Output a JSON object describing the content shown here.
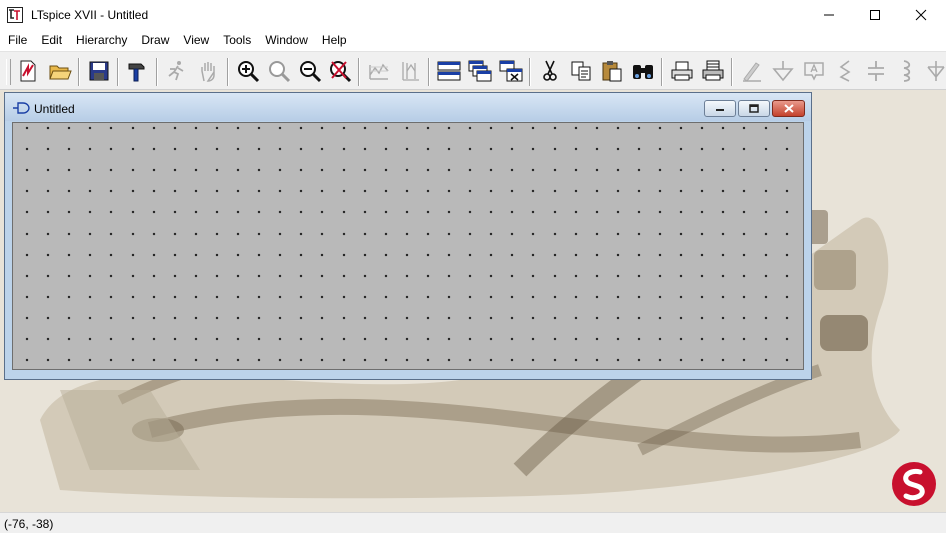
{
  "window": {
    "title": "LTspice XVII - Untitled",
    "controls": {
      "minimize": "minimize-icon",
      "maximize": "maximize-icon",
      "close": "close-icon"
    }
  },
  "menu": {
    "items": [
      {
        "label": "File"
      },
      {
        "label": "Edit"
      },
      {
        "label": "Hierarchy"
      },
      {
        "label": "Draw"
      },
      {
        "label": "View"
      },
      {
        "label": "Tools"
      },
      {
        "label": "Window"
      },
      {
        "label": "Help"
      }
    ]
  },
  "toolbar": {
    "buttons": [
      {
        "icon": "new-schematic-icon"
      },
      {
        "icon": "open-folder-icon"
      },
      {
        "icon": "save-icon"
      },
      {
        "icon": "control-panel-hammer-icon"
      },
      {
        "icon": "run-icon",
        "disabled": true
      },
      {
        "icon": "halt-hand-icon",
        "disabled": true
      },
      {
        "icon": "zoom-in-icon"
      },
      {
        "icon": "zoom-fit-icon"
      },
      {
        "icon": "zoom-out-icon"
      },
      {
        "icon": "zoom-cancel-icon"
      },
      {
        "icon": "autorange-icon",
        "disabled": true
      },
      {
        "icon": "vertical-autorange-icon",
        "disabled": true
      },
      {
        "icon": "tile-windows-icon"
      },
      {
        "icon": "cascade-windows-icon"
      },
      {
        "icon": "close-all-windows-icon"
      },
      {
        "icon": "cut-icon"
      },
      {
        "icon": "copy-icon"
      },
      {
        "icon": "paste-icon"
      },
      {
        "icon": "find-binoculars-icon"
      },
      {
        "icon": "print-preview-icon"
      },
      {
        "icon": "print-icon"
      },
      {
        "icon": "draw-wire-icon",
        "disabled": true
      },
      {
        "icon": "ground-icon",
        "disabled": true
      },
      {
        "icon": "label-net-icon",
        "disabled": true
      },
      {
        "icon": "resistor-icon",
        "disabled": true
      },
      {
        "icon": "capacitor-icon",
        "disabled": true
      },
      {
        "icon": "inductor-icon",
        "disabled": true
      },
      {
        "icon": "diode-icon",
        "disabled": true
      }
    ]
  },
  "document": {
    "title": "Untitled",
    "icon": "schematic-doc-icon"
  },
  "status": {
    "coordinates": "(-76, -38)"
  },
  "colors": {
    "accent_red": "#c8102e",
    "grid_background": "#b9b9b9",
    "grid_dots": "#000000"
  }
}
